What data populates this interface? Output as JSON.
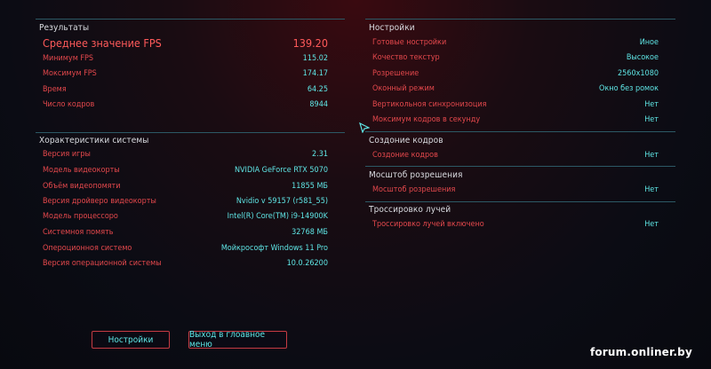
{
  "results": {
    "title": "Результаты",
    "rows": [
      {
        "label": "Среднее значение FPS",
        "value": "139.20"
      },
      {
        "label": "Минимум FPS",
        "value": "115.02"
      },
      {
        "label": "Моксимум FPS",
        "value": "174.17"
      },
      {
        "label": "Время",
        "value": "64.25"
      },
      {
        "label": "Число кодров",
        "value": "8944"
      }
    ]
  },
  "system": {
    "title": "Хорактеристики системы",
    "rows": [
      {
        "label": "Версия игры",
        "value": "2.31"
      },
      {
        "label": "Модель видеокорты",
        "value": "NVIDIA GeForce RTX 5070"
      },
      {
        "label": "Объём видеопомяти",
        "value": "11855 МБ"
      },
      {
        "label": "Версия дройверо видеокорты",
        "value": "Nvidio v 59157 (r581_55)"
      },
      {
        "label": "Модель процессоро",
        "value": "Intel(R) Core(TM) i9-14900K"
      },
      {
        "label": "Системноя помять",
        "value": "32768 МБ"
      },
      {
        "label": "Оперοционнοя системо",
        "value": "Мойкрософт Windows 11 Pro"
      },
      {
        "label": "Версия операционной системы",
        "value": "10.0.26200"
      }
    ]
  },
  "settings": {
    "title": "Нострoйки",
    "rows": [
      {
        "label": "Готовые нострoйки",
        "value": "Иное"
      },
      {
        "label": "Кочество текстур",
        "value": "Высокое"
      },
      {
        "label": "Розрешение",
        "value": "2560x1080"
      },
      {
        "label": "Оконный режим",
        "value": "Окно без ромок"
      },
      {
        "label": "Вертикольноя синхронизоция",
        "value": "Нет"
      },
      {
        "label": "Моксимум кодров в секунду",
        "value": "Нет"
      }
    ]
  },
  "frame_gen": {
    "title": "Создоние кодров",
    "rows": [
      {
        "label": "Создоние кодров",
        "value": "Нет"
      }
    ]
  },
  "res_scale": {
    "title": "Мосштоб розрешения",
    "rows": [
      {
        "label": "Мосштоб розрешения",
        "value": "Нет"
      }
    ]
  },
  "raytracing": {
    "title": "Троссировко лучей",
    "rows": [
      {
        "label": "Троссировко лучей включено",
        "value": "Нет"
      }
    ]
  },
  "buttons": {
    "settings": "Нострoйки",
    "main_menu": "Выход в глоавное меню"
  },
  "watermark": "forum.onliner.by",
  "colors": {
    "label": "#e4484c",
    "value": "#5fe6e6",
    "divider": "#2c5965",
    "title": "#d9dbe0"
  }
}
